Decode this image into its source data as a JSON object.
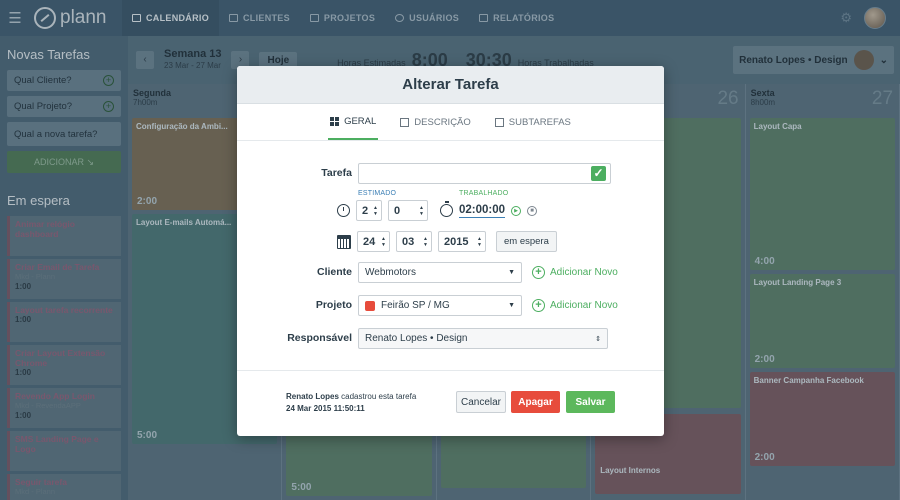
{
  "app": {
    "logo_text": "plann"
  },
  "nav": {
    "items": [
      {
        "label": "CALENDÁRIO",
        "active": true
      },
      {
        "label": "CLIENTES",
        "active": false
      },
      {
        "label": "PROJETOS",
        "active": false
      },
      {
        "label": "USUÁRIOS",
        "active": false
      },
      {
        "label": "RELATÓRIOS",
        "active": false
      }
    ]
  },
  "sidebar": {
    "new_title": "Novas Tarefas",
    "client_placeholder": "Qual Cliente?",
    "project_placeholder": "Qual Projeto?",
    "task_placeholder": "Qual a nova tarefa?",
    "add_label": "ADICIONAR",
    "waiting_title": "Em espera",
    "waiting": [
      {
        "title": "Animar relógio dashboard",
        "sub": "",
        "time": ""
      },
      {
        "title": "Criar Email de Tarefa",
        "sub": "Mkd - Plann",
        "time": "1:00"
      },
      {
        "title": "Layout tarefa recorrente",
        "sub": "",
        "time": "1:00"
      },
      {
        "title": "Criar Layout Extensão Chrome",
        "sub": "",
        "time": "1:00"
      },
      {
        "title": "Revendo App Login",
        "sub": "Mkd - RevendaAPP",
        "time": "1:00"
      },
      {
        "title": "SMS Landing Page e Logo",
        "sub": "",
        "time": ""
      },
      {
        "title": "Seguir tarefa",
        "sub": "Mkd - Plann",
        "time": ""
      }
    ]
  },
  "calendar": {
    "week_label": "Semana 13",
    "week_range": "23 Mar - 27 Mar",
    "today_label": "Hoje",
    "hours_estimated_label": "Horas Estimadas",
    "hours_estimated": "8:00",
    "hours_worked": "30:30",
    "hours_worked_label": "Horas Trabalhadas",
    "user": "Renato Lopes • Design",
    "days": [
      {
        "name": "Segunda",
        "hours": "7h00m",
        "num": ""
      },
      {
        "name": "",
        "hours": "",
        "num": ""
      },
      {
        "name": "",
        "hours": "",
        "num": ""
      },
      {
        "name": "",
        "hours": "",
        "num": "26"
      },
      {
        "name": "Sexta",
        "hours": "8h00m",
        "num": "27"
      }
    ],
    "cards": [
      {
        "title": "Configuração da Ambi...",
        "time": "2:00"
      },
      {
        "title": "Layout E-mails Automá...",
        "time": "5:00"
      },
      {
        "title": "Layout Capa",
        "time": "4:00"
      },
      {
        "title": "Layout Landing Page 3",
        "time": "2:00"
      },
      {
        "title": "Banner Campanha Facebook",
        "time": "2:00"
      },
      {
        "title": "",
        "time": "5:00"
      },
      {
        "title": "Layout Internos",
        "time": ""
      }
    ]
  },
  "modal": {
    "title": "Alterar Tarefa",
    "tabs": [
      "GERAL",
      "DESCRIÇÃO",
      "SUBTAREFAS"
    ],
    "task_label": "Tarefa",
    "task_value": "",
    "estimated_label": "ESTIMADO",
    "worked_label": "TRABALHADO",
    "est_hours": "2",
    "est_minutes": "0",
    "worked_value": "02:00:00",
    "date_day": "24",
    "date_month": "03",
    "date_year": "2015",
    "wait_button": "em espera",
    "client_label": "Cliente",
    "client_value": "Webmotors",
    "add_new": "Adicionar Novo",
    "project_label": "Projeto",
    "project_value": "Feirão SP / MG",
    "project_color": "#e74c3c",
    "responsible_label": "Responsável",
    "responsible_value": "Renato Lopes • Design",
    "created_by": "Renato Lopes",
    "created_text": "cadastrou esta tarefa",
    "created_at": "24 Mar 2015 11:50:11",
    "cancel": "Cancelar",
    "delete": "Apagar",
    "save": "Salvar"
  }
}
